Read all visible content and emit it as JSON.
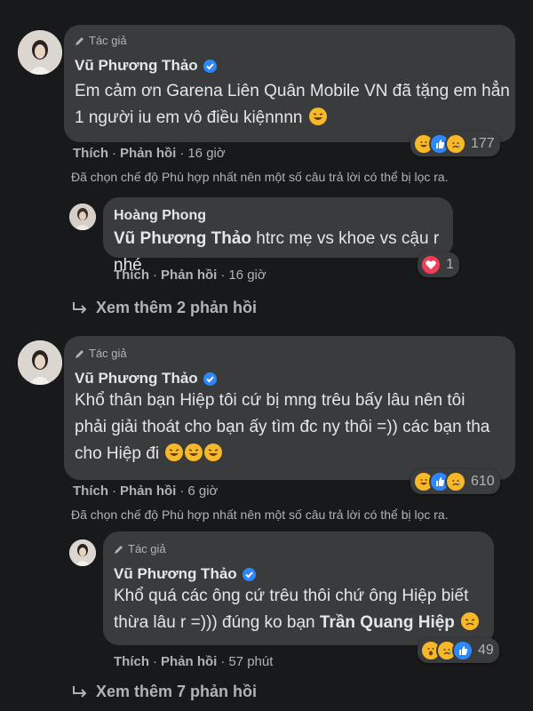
{
  "author_tag": "Tác giả",
  "comments": [
    {
      "name": "Vũ Phương Thảo",
      "line1": "Em cảm ơn Garena Liên Quân Mobile VN đã tặng em hẳn",
      "line2": "1 người iu em vô điều kiệnnnn",
      "reaction_count": "177",
      "like": "Thích",
      "reply": "Phản hồi",
      "time": "16 giờ"
    },
    {
      "name": "Hoàng Phong",
      "mention": "Vũ Phương Thảo",
      "text": "htrc mẹ vs khoe vs cậu r nhé",
      "reaction_count": "1",
      "like": "Thích",
      "reply": "Phản hồi",
      "time": "16 giờ"
    },
    {
      "name": "Vũ Phương Thảo",
      "line1": "Khổ thân bạn Hiệp tôi cứ bị mng trêu bấy lâu nên tôi",
      "line2": "phải giải thoát cho bạn ấy tìm đc ny thôi =)) các bạn tha",
      "line3": "cho Hiệp đi",
      "reaction_count": "610",
      "like": "Thích",
      "reply": "Phản hồi",
      "time": "6 giờ"
    },
    {
      "name": "Vũ Phương Thảo",
      "line1": "Khổ quá các ông cứ trêu thôi chứ ông Hiệp biết",
      "line2a": "thừa lâu r =))) đúng ko bạn",
      "mention": "Trần Quang Hiệp",
      "reaction_count": "49",
      "like": "Thích",
      "reply": "Phản hồi",
      "time": "57 phút"
    }
  ],
  "filter_notice": "Đã chọn chế độ Phù hợp nhất nên một số câu trả lời có thể bị lọc ra.",
  "more_replies_1": "Xem thêm 2 phản hồi",
  "more_replies_2": "Xem thêm 7 phản hồi",
  "colors": {
    "background": "#18191a",
    "bubble": "#3a3b3c",
    "text": "#e4e6eb",
    "secondary": "#b0b3b8",
    "verified": "#2d88ff"
  }
}
